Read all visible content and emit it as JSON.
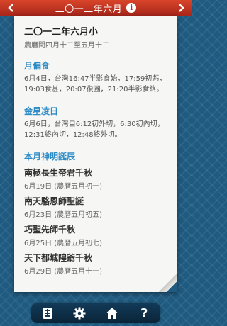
{
  "header": {
    "prev_icon": "chevron-left-icon",
    "next_icon": "chevron-right-icon",
    "title": "二〇一二年六月",
    "info_label": "i"
  },
  "month": {
    "title": "二〇一二年六月小",
    "subtitle": "農曆閏四月十二至五月十二"
  },
  "eclipse": {
    "heading": "月偏食",
    "text": "6月4日，台灣16:47半影食始，17:59初虧，19:03食甚，20:07復圓，21:20半影食終。"
  },
  "transit": {
    "heading": "金星凌日",
    "text": "6月6日，台灣自6:12初外切，6:30初內切，12:31終內切，12:48終外切。"
  },
  "festivals": {
    "heading": "本月神明誕辰",
    "items": [
      {
        "name": "南極長生帝君千秋",
        "date": "6月19日 (農曆五月初一)"
      },
      {
        "name": "南天駱恩師聖誕",
        "date": "6月23日 (農曆五月初五)"
      },
      {
        "name": "巧聖先師千秋",
        "date": "6月25日 (農曆五月初七)"
      },
      {
        "name": "天下都城隍爺千秋",
        "date": "6月29日 (農曆五月十一)"
      }
    ]
  },
  "toolbar": {
    "book_icon": "book-icon",
    "settings_icon": "gear-icon",
    "home_icon": "home-icon",
    "help_icon": "help-icon",
    "help_label": "?"
  },
  "colors": {
    "header": "#c0301f",
    "accent": "#2d8bc6",
    "background": "#1f5a80"
  }
}
